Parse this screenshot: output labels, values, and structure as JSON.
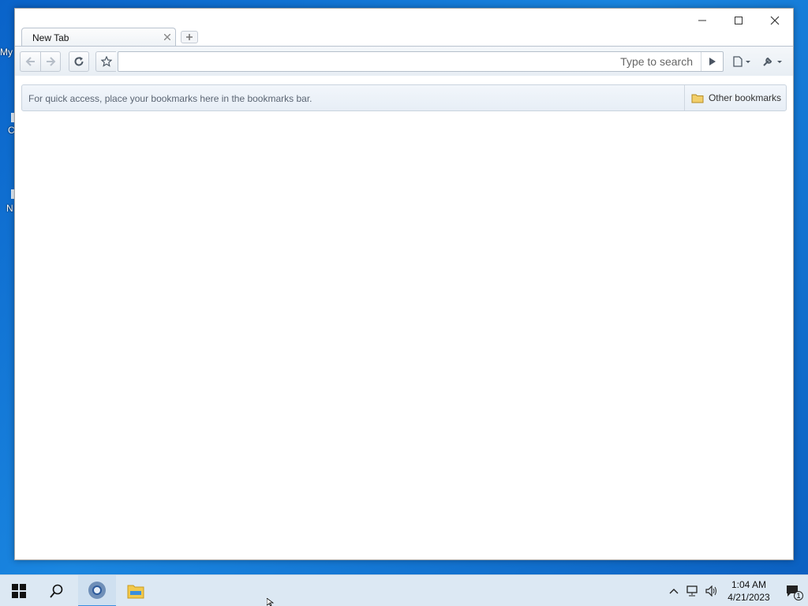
{
  "desktop": {
    "fragments": [
      "My",
      "C",
      "N"
    ]
  },
  "browser": {
    "tab": {
      "title": "New Tab"
    },
    "omnibox": {
      "value": "",
      "placeholder": "Type to search"
    },
    "bookmarks_bar": {
      "hint": "For quick access, place your bookmarks here in the bookmarks bar.",
      "other_label": "Other bookmarks"
    }
  },
  "icons": [
    "minimize-icon",
    "maximize-icon",
    "close-icon",
    "back-icon",
    "forward-icon",
    "reload-icon",
    "star-icon",
    "go-icon",
    "page-menu-icon",
    "wrench-icon",
    "folder-icon",
    "windows-start-icon",
    "search-icon",
    "chromium-icon",
    "file-explorer-icon",
    "chevron-up-icon",
    "network-icon",
    "volume-icon",
    "notification-icon"
  ],
  "taskbar": {
    "clock": {
      "time": "1:04 AM",
      "date": "4/21/2023"
    },
    "notification_count": "1"
  },
  "colors": {
    "desktop": "#0a63c9",
    "taskbar": "#dce8f3",
    "accent": "#3a8fde"
  }
}
